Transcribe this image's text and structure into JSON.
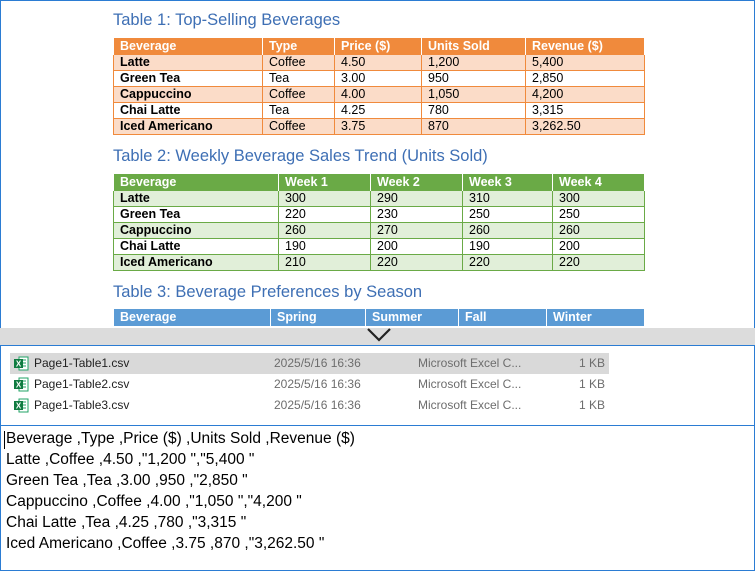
{
  "document": {
    "table1": {
      "title": "Table 1: Top-Selling Beverages",
      "headers": [
        "Beverage",
        "Type",
        "Price ($)",
        "Units Sold",
        "Revenue ($)"
      ],
      "rows": [
        [
          "Latte",
          "Coffee",
          "4.50",
          "1,200",
          "5,400"
        ],
        [
          "Green Tea",
          "Tea",
          "3.00",
          "950",
          "2,850"
        ],
        [
          "Cappuccino",
          "Coffee",
          "4.00",
          "1,050",
          "4,200"
        ],
        [
          "Chai Latte",
          "Tea",
          "4.25",
          "780",
          "3,315"
        ],
        [
          "Iced Americano",
          "Coffee",
          "3.75",
          "870",
          "3,262.50"
        ]
      ],
      "accent": "#f08a3c"
    },
    "table2": {
      "title": "Table 2: Weekly Beverage Sales Trend (Units Sold)",
      "headers": [
        "Beverage",
        "Week 1",
        "Week 2",
        "Week 3",
        "Week 4"
      ],
      "rows": [
        [
          "Latte",
          "300",
          "290",
          "310",
          "300"
        ],
        [
          "Green Tea",
          "220",
          "230",
          "250",
          "250"
        ],
        [
          "Cappuccino",
          "260",
          "270",
          "260",
          "260"
        ],
        [
          "Chai Latte",
          "190",
          "200",
          "190",
          "200"
        ],
        [
          "Iced Americano",
          "210",
          "220",
          "220",
          "220"
        ]
      ],
      "accent": "#6aaa46"
    },
    "table3": {
      "title": "Table 3: Beverage Preferences by Season",
      "headers": [
        "Beverage",
        "Spring",
        "Summer",
        "Fall",
        "Winter"
      ],
      "accent": "#5b9bd5"
    }
  },
  "separator": {
    "icon": "chevron-down-icon"
  },
  "files": [
    {
      "name": "Page1-Table1.csv",
      "date": "2025/5/16 16:36",
      "type": "Microsoft Excel C...",
      "size": "1 KB",
      "icon": "excel-icon",
      "selected": true
    },
    {
      "name": "Page1-Table2.csv",
      "date": "2025/5/16 16:36",
      "type": "Microsoft Excel C...",
      "size": "1 KB",
      "icon": "excel-icon",
      "selected": false
    },
    {
      "name": "Page1-Table3.csv",
      "date": "2025/5/16 16:36",
      "type": "Microsoft Excel C...",
      "size": "1 KB",
      "icon": "excel-icon",
      "selected": false
    }
  ],
  "csv_preview": {
    "lines": [
      "Beverage ,Type ,Price ($) ,Units Sold ,Revenue ($)",
      "Latte ,Coffee ,4.50 ,\"1,200 \",\"5,400 \"",
      "Green Tea ,Tea ,3.00 ,950 ,\"2,850 \"",
      "Cappuccino ,Coffee ,4.00 ,\"1,050 \",\"4,200 \"",
      "Chai Latte ,Tea ,4.25 ,780 ,\"3,315 \"",
      "Iced Americano ,Coffee ,3.75 ,870 ,\"3,262.50 \""
    ]
  }
}
